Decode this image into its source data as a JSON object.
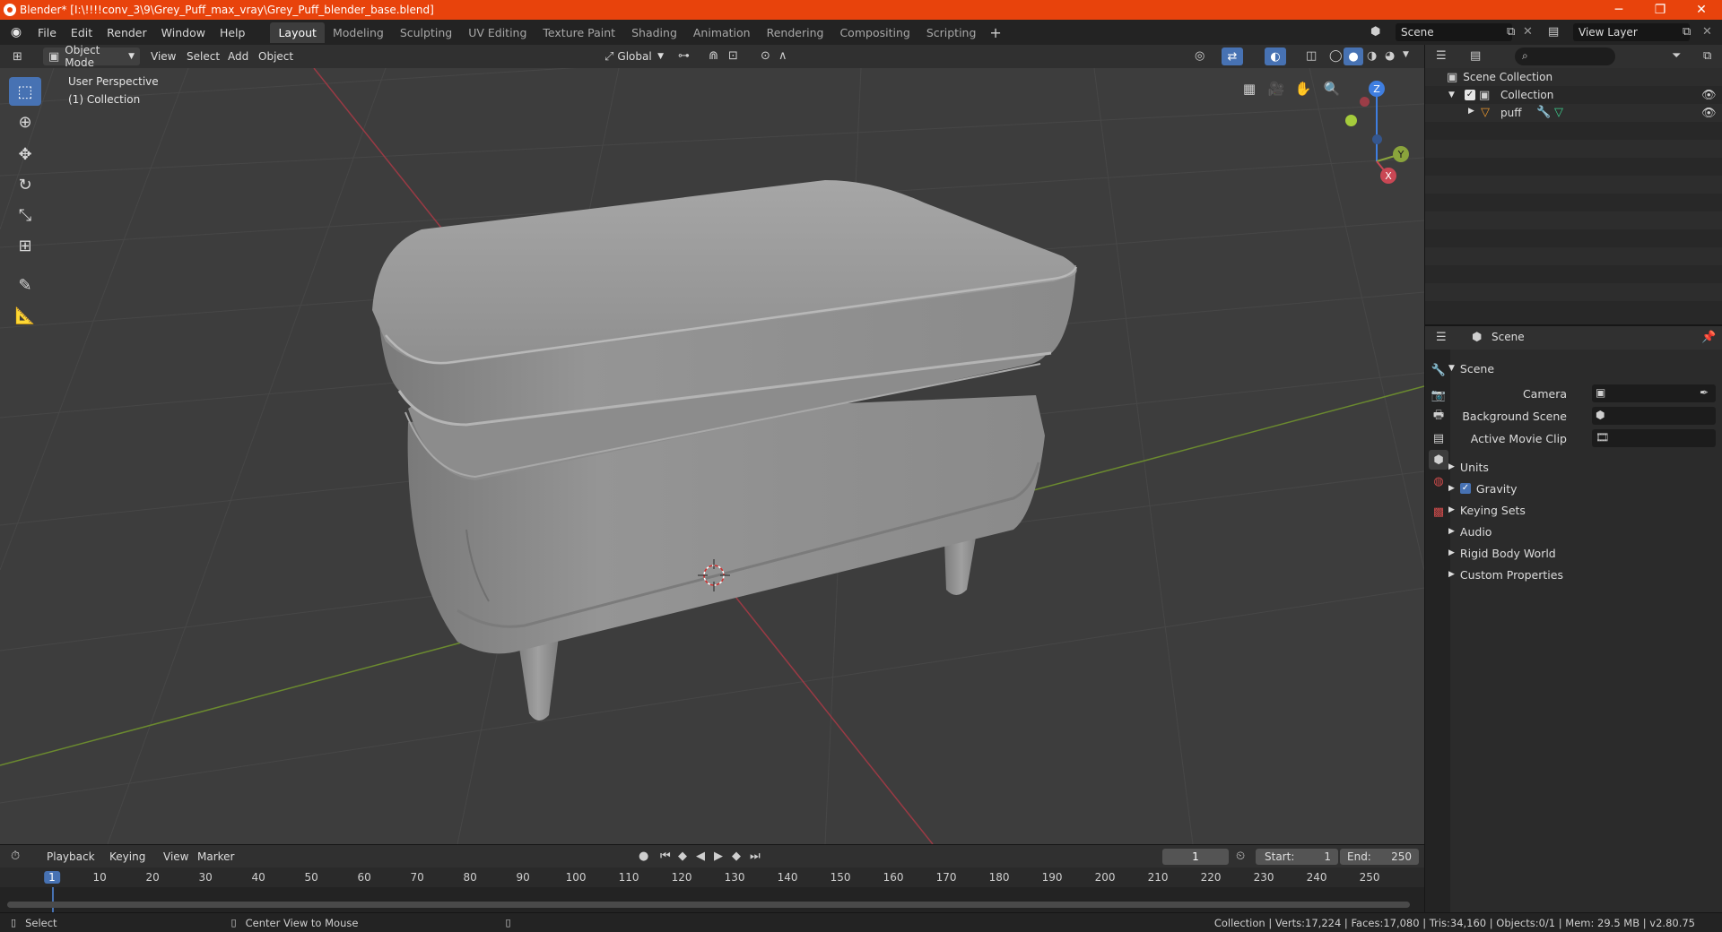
{
  "window": {
    "title": "Blender* [I:\\!!!!conv_3\\9\\Grey_Puff_max_vray\\Grey_Puff_blender_base.blend]",
    "minimize": "─",
    "maximize": "❐",
    "close": "✕"
  },
  "menus": [
    "File",
    "Edit",
    "Render",
    "Window",
    "Help"
  ],
  "workspace_tabs": [
    "Layout",
    "Modeling",
    "Sculpting",
    "UV Editing",
    "Texture Paint",
    "Shading",
    "Animation",
    "Rendering",
    "Compositing",
    "Scripting"
  ],
  "workspace_active": "Layout",
  "scene_field": "Scene",
  "view_layer_field": "View Layer",
  "viewport_header": {
    "mode": "Object Mode",
    "menus": [
      "View",
      "Select",
      "Add",
      "Object"
    ],
    "orientation": "Global"
  },
  "viewport": {
    "perspective": "User Perspective",
    "collection": "(1) Collection",
    "gizmo": {
      "z": "Z",
      "y": "Y",
      "x": "X"
    }
  },
  "outliner": {
    "root": "Scene Collection",
    "collection": "Collection",
    "object": "puff"
  },
  "properties": {
    "header": "Scene",
    "panel": "Scene",
    "camera_label": "Camera",
    "background_scene_label": "Background Scene",
    "active_movie_clip_label": "Active Movie Clip",
    "sections": [
      "Units",
      "Gravity",
      "Keying Sets",
      "Audio",
      "Rigid Body World",
      "Custom Properties"
    ],
    "gravity_enabled": true
  },
  "timeline": {
    "menus": [
      "Playback",
      "Keying",
      "View",
      "Marker"
    ],
    "current_frame": "1",
    "start_label": "Start:",
    "start_value": "1",
    "end_label": "End:",
    "end_value": "250",
    "ruler": [
      "1",
      "10",
      "20",
      "30",
      "40",
      "50",
      "60",
      "70",
      "80",
      "90",
      "100",
      "110",
      "120",
      "130",
      "140",
      "150",
      "160",
      "170",
      "180",
      "190",
      "200",
      "210",
      "220",
      "230",
      "240",
      "250"
    ]
  },
  "statusbar": {
    "left_action": "Select",
    "middle_action": "Center View to Mouse",
    "stats": "Collection | Verts:17,224 | Faces:17,080 | Tris:34,160 | Objects:0/1 | Mem: 29.5 MB | v2.80.75"
  },
  "colors": {
    "titlebar": "#e8430c",
    "active_tool": "#4772b3",
    "x_axis": "#c94754",
    "y_axis": "#8aa43c",
    "z_axis": "#3f7ee0"
  }
}
